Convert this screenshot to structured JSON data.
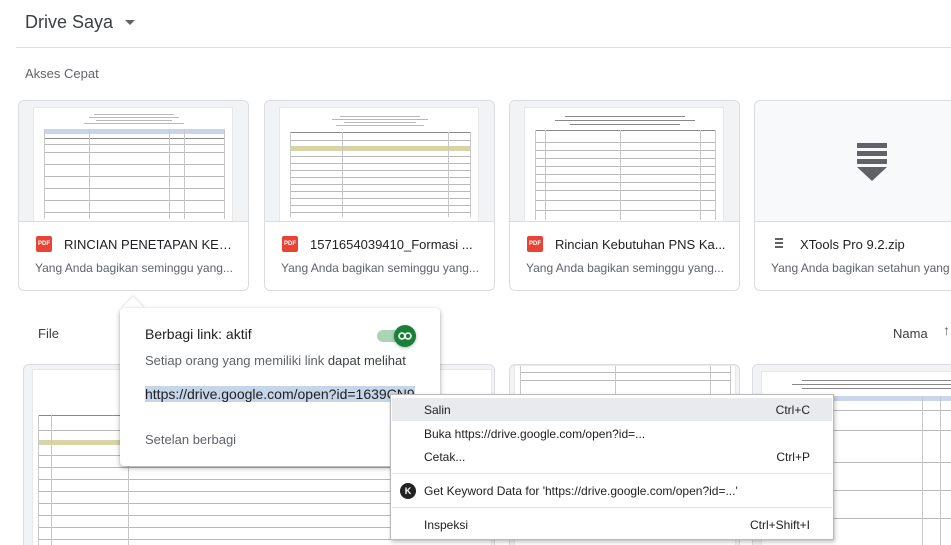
{
  "header": {
    "title": "Drive Saya"
  },
  "quick_access": {
    "label": "Akses Cepat",
    "cards": [
      {
        "title": "RINCIAN PENETAPAN KEB...",
        "subtitle": "Yang Anda bagikan seminggu yang...",
        "type": "pdf"
      },
      {
        "title": "1571654039410_Formasi ...",
        "subtitle": "Yang Anda bagikan seminggu yang...",
        "type": "pdf"
      },
      {
        "title": "Rincian Kebutuhan PNS Ka...",
        "subtitle": "Yang Anda bagikan seminggu yang...",
        "type": "pdf"
      },
      {
        "title": "XTools Pro 9.2.zip",
        "subtitle": "Yang Anda bagikan setahun yang",
        "type": "zip"
      }
    ]
  },
  "file_list": {
    "label": "File",
    "sort_label": "Nama",
    "sort_arrow": "↑"
  },
  "share_popup": {
    "title": "Berbagi link: aktif",
    "desc_prefix": "Setiap orang yang memiliki link",
    "desc_emphasis": "dapat melihat",
    "link": "https://drive.google.com/open?id=1639CN9",
    "settings": "Setelan berbagi",
    "toggle_on": true
  },
  "context_menu": {
    "items": [
      {
        "label": "Salin",
        "shortcut": "Ctrl+C"
      },
      {
        "label": "Buka https://drive.google.com/open?id=...",
        "shortcut": ""
      },
      {
        "label": "Cetak...",
        "shortcut": "Ctrl+P"
      },
      {
        "label": "Get Keyword Data for 'https://drive.google.com/open?id=...'",
        "shortcut": "",
        "icon": "K"
      },
      {
        "label": "Inspeksi",
        "shortcut": "Ctrl+Shift+I"
      }
    ]
  },
  "colors": {
    "pdf_red": "#ea4335",
    "toggle_green": "#188038",
    "highlight": "#c6d5e8"
  }
}
